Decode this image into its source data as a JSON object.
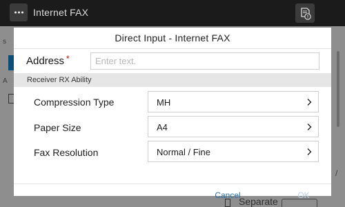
{
  "topbar": {
    "title": "Internet FAX",
    "menu_icon": "ellipsis-icon",
    "job_icon": "job-status-icon"
  },
  "background": {
    "left_char_1": "s",
    "left_char_2": "A",
    "right_char": "/",
    "bottom_text": "Separate"
  },
  "dialog": {
    "title": "Direct Input - Internet FAX",
    "address": {
      "label": "Address",
      "required_mark": "*",
      "placeholder": "Enter text.",
      "value": ""
    },
    "section_title": "Receiver RX Ability",
    "rows": [
      {
        "label": "Compression Type",
        "value": "MH"
      },
      {
        "label": "Paper Size",
        "value": "A4"
      },
      {
        "label": "Fax Resolution",
        "value": "Normal / Fine"
      }
    ],
    "cancel_label": "Cancel",
    "ok_label": "OK"
  },
  "colors": {
    "accent": "#2a6fa5",
    "required": "#d40000",
    "topbar": "#1b1b1b",
    "ok_disabled": "#bcd3e3"
  }
}
